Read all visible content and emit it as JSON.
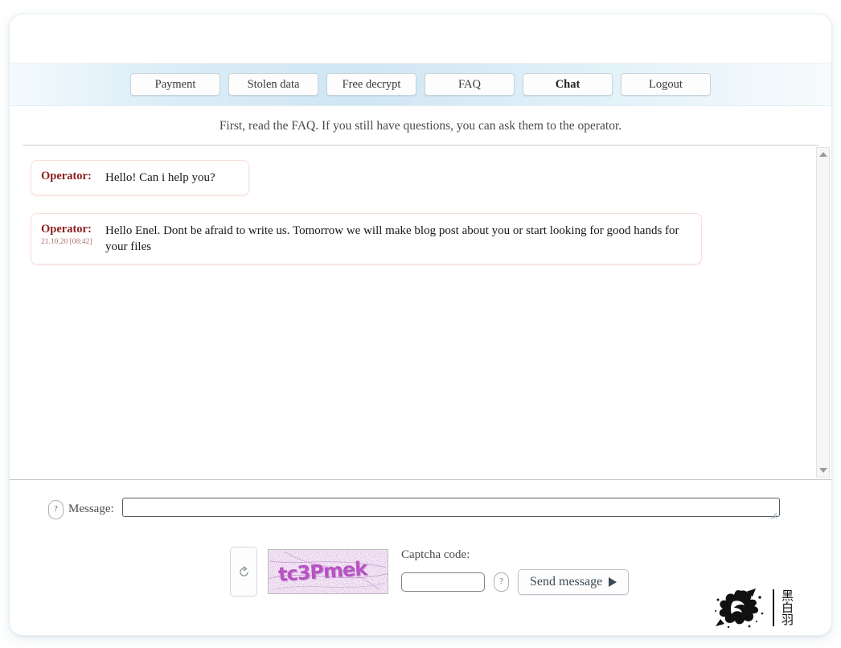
{
  "nav": {
    "items": [
      {
        "label": "Payment",
        "active": false
      },
      {
        "label": "Stolen data",
        "active": false
      },
      {
        "label": "Free decrypt",
        "active": false
      },
      {
        "label": "FAQ",
        "active": false
      },
      {
        "label": "Chat",
        "active": true
      },
      {
        "label": "Logout",
        "active": false
      }
    ]
  },
  "instruction": "First, read the FAQ. If you still have questions, you can ask them to the operator.",
  "chat": {
    "messages": [
      {
        "author": "Operator:",
        "time": "",
        "text": "Hello! Can i help you?"
      },
      {
        "author": "Operator:",
        "time": "21.10.20 [08:42]",
        "text": "Hello Enel. Dont be afraid to write us. Tomorrow we will make blog post about you or start looking for good hands for your files"
      }
    ],
    "scrollbar": {
      "up_icon": "triangle-up-icon",
      "down_icon": "triangle-down-icon"
    }
  },
  "compose": {
    "help_label": "?",
    "message_label": "Message:",
    "message_value": "",
    "message_placeholder": ""
  },
  "captcha": {
    "refresh_icon": "refresh-icon",
    "image_text": "tc3Pmek",
    "code_label": "Captcha code:",
    "code_value": "",
    "code_placeholder": "",
    "help_label": "?",
    "send_label": "Send message",
    "send_icon": "play-triangle-icon"
  },
  "footer": {
    "logo_icon": "ink-splatter-logo",
    "logo_text_lines": [
      "黑",
      "白",
      "羽"
    ]
  },
  "colors": {
    "nav_gradient_mid": "#cfe6f3",
    "message_border": "#fadfd9",
    "author_color": "#8a1f1f",
    "timestamp_color": "#b07070",
    "captcha_text": "#b43fc0"
  }
}
